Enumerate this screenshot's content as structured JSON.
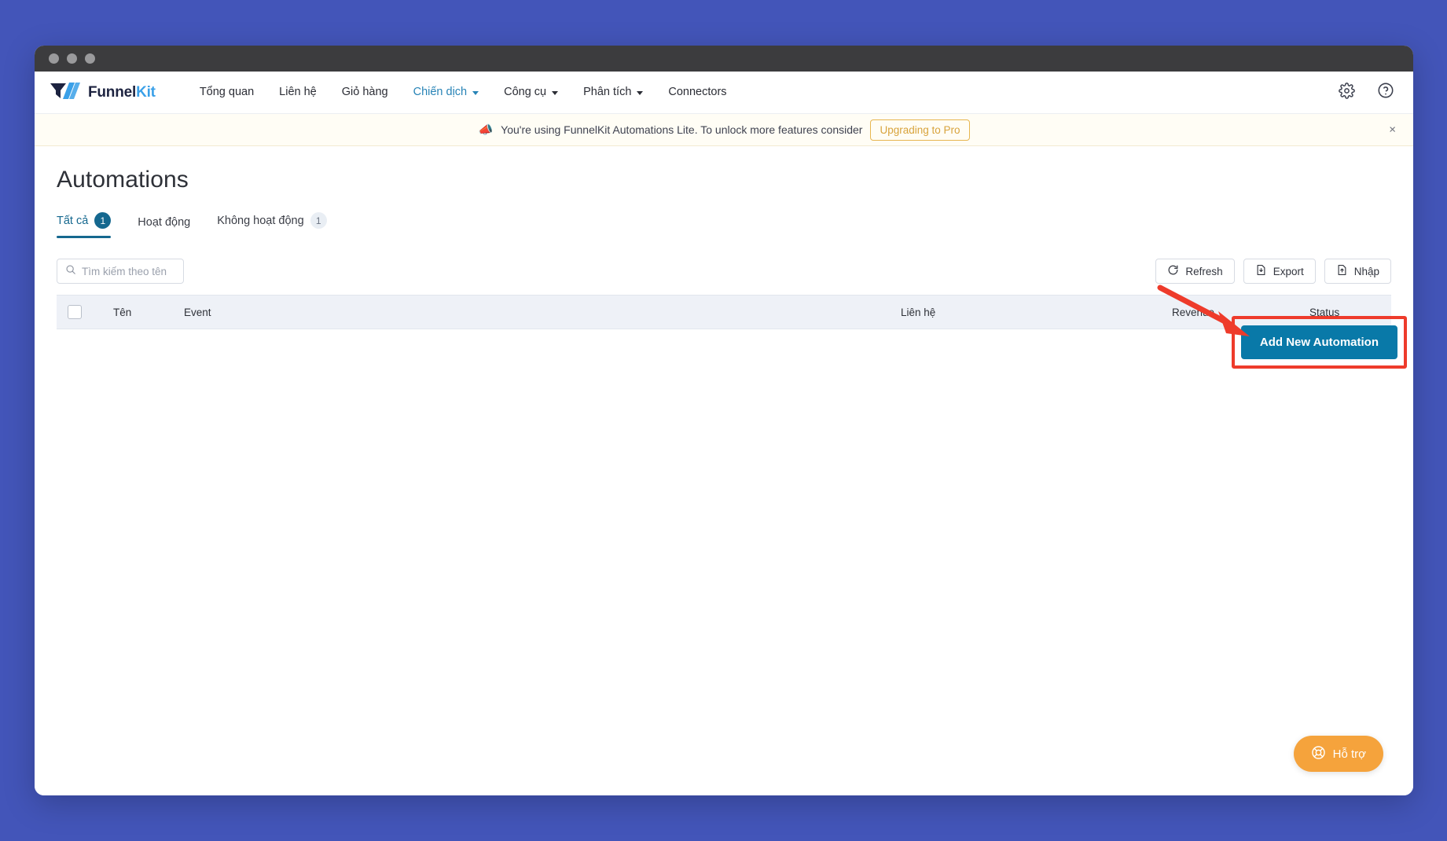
{
  "window": {
    "traffic_lights": [
      "close",
      "minimize",
      "maximize"
    ]
  },
  "brand": {
    "name_part1": "Funnel",
    "name_part2": "Kit",
    "logo_icon": "funnelkit-logo-icon",
    "color_dark": "#1d2340",
    "color_accent": "#3aa0e8"
  },
  "topnav": {
    "items": [
      {
        "label": "Tổng quan",
        "has_caret": false,
        "active": false
      },
      {
        "label": "Liên hệ",
        "has_caret": false,
        "active": false
      },
      {
        "label": "Giỏ hàng",
        "has_caret": false,
        "active": false
      },
      {
        "label": "Chiến dịch",
        "has_caret": true,
        "active": true
      },
      {
        "label": "Công cụ",
        "has_caret": true,
        "active": false
      },
      {
        "label": "Phân tích",
        "has_caret": true,
        "active": false
      },
      {
        "label": "Connectors",
        "has_caret": false,
        "active": false
      }
    ],
    "settings_icon": "gear-icon",
    "help_icon": "help-circle-icon"
  },
  "notice": {
    "icon": "megaphone-icon",
    "text": "You're using FunnelKit Automations Lite. To unlock more features consider",
    "cta_label": "Upgrading to Pro",
    "close_label": "×",
    "accent_color": "#d8a33c",
    "background": "#fffdf5"
  },
  "page": {
    "title": "Automations"
  },
  "tabs": [
    {
      "label": "Tất cả",
      "count": "1",
      "active": true,
      "badge_style": "primary"
    },
    {
      "label": "Hoạt động",
      "count": "",
      "active": false,
      "badge_style": "none"
    },
    {
      "label": "Không hoạt động",
      "count": "1",
      "active": false,
      "badge_style": "muted"
    }
  ],
  "primary_action": {
    "label": "Add New Automation",
    "color": "#0979a8",
    "highlight_color": "#ee3b2b",
    "annotation": "red-arrow-pointing-to-button"
  },
  "search": {
    "placeholder": "Tìm kiếm theo tên",
    "value": "",
    "icon": "search-icon"
  },
  "toolbar_buttons": [
    {
      "label": "Refresh",
      "icon": "refresh-icon"
    },
    {
      "label": "Export",
      "icon": "export-file-icon"
    },
    {
      "label": "Nhập",
      "icon": "import-file-icon"
    }
  ],
  "table": {
    "select_all_checked": false,
    "columns": [
      "Tên",
      "Event",
      "Liên hệ",
      "Revenue",
      "Status"
    ],
    "rows": []
  },
  "support": {
    "label": "Hỗ trợ",
    "icon": "lifebuoy-icon",
    "color": "#f5a33c"
  }
}
